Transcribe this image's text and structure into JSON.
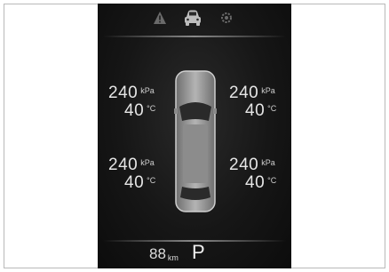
{
  "top_icons": [
    {
      "name": "warning-triangle-icon",
      "color": "#6a6a6a"
    },
    {
      "name": "car-front-icon",
      "color": "#bdbdbd"
    },
    {
      "name": "settings-gear-icon",
      "color": "#6a6a6a"
    }
  ],
  "tires": {
    "front_left": {
      "pressure": "240",
      "pressure_unit": "kPa",
      "temp": "40",
      "temp_unit": "°C"
    },
    "front_right": {
      "pressure": "240",
      "pressure_unit": "kPa",
      "temp": "40",
      "temp_unit": "°C"
    },
    "rear_left": {
      "pressure": "240",
      "pressure_unit": "kPa",
      "temp": "40",
      "temp_unit": "°C"
    },
    "rear_right": {
      "pressure": "240",
      "pressure_unit": "kPa",
      "temp": "40",
      "temp_unit": "°C"
    }
  },
  "status": {
    "range": "88",
    "range_unit": "km",
    "gear": "P"
  },
  "colors": {
    "display_bg": "#141414",
    "text": "#e6e6e6",
    "car_body": "#9a9a9a"
  }
}
